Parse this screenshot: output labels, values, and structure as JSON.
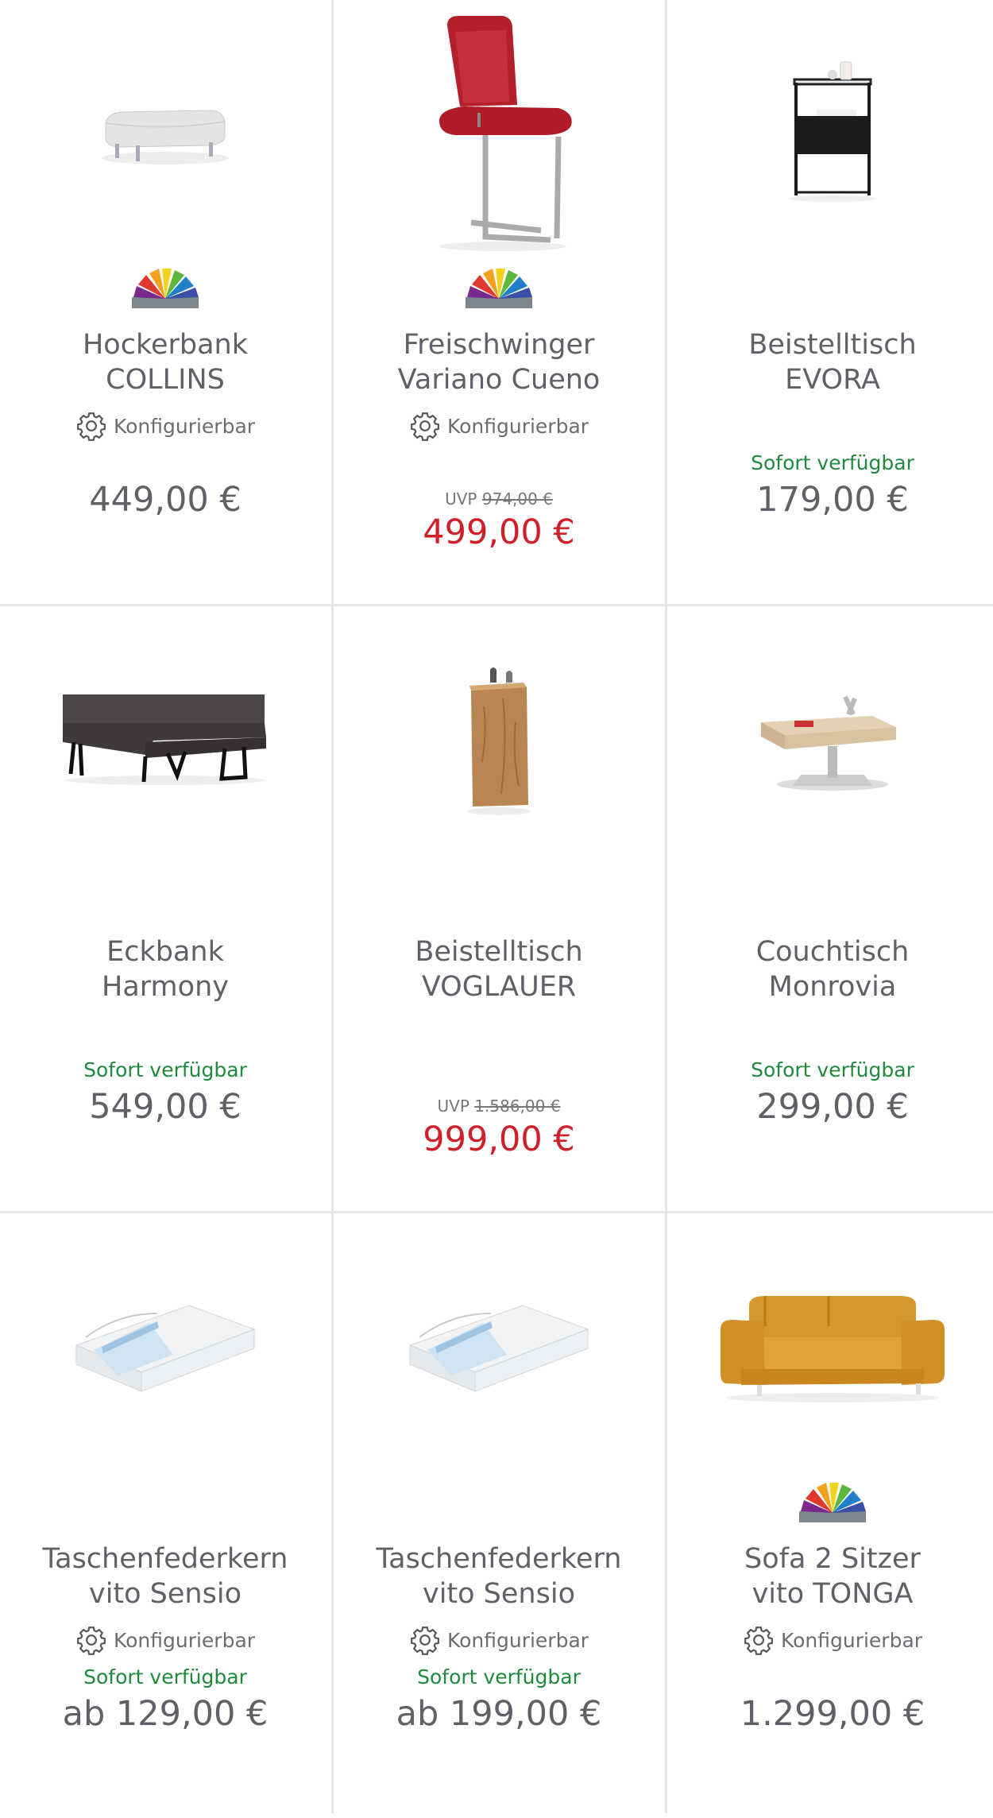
{
  "products": [
    {
      "title_line1": "Hockerbank",
      "title_line2": "COLLINS",
      "configurable": "Konfigurierbar",
      "availability": "",
      "price": "449,00 €",
      "uvp_label": "",
      "uvp_price": "",
      "image": "ottoman-image",
      "has_colors": true
    },
    {
      "title_line1": "Freischwinger",
      "title_line2": "Variano Cueno",
      "configurable": "Konfigurierbar",
      "availability": "",
      "price": "",
      "uvp_label": "UVP",
      "uvp_price": "974,00 €",
      "sale_price": "499,00 €",
      "image": "chair-image",
      "has_colors": true
    },
    {
      "title_line1": "Beistelltisch",
      "title_line2": "EVORA",
      "configurable": "",
      "availability": "Sofort verfügbar",
      "price": "179,00 €",
      "uvp_label": "",
      "uvp_price": "",
      "image": "side-table-image",
      "has_colors": false
    },
    {
      "title_line1": "Eckbank",
      "title_line2": "Harmony",
      "configurable": "",
      "availability": "Sofort verfügbar",
      "price": "549,00 €",
      "uvp_label": "",
      "uvp_price": "",
      "image": "corner-bench-image",
      "has_colors": false
    },
    {
      "title_line1": "Beistelltisch",
      "title_line2": "VOGLAUER",
      "configurable": "",
      "availability": "",
      "price": "",
      "uvp_label": "UVP",
      "uvp_price": "1.586,00 €",
      "sale_price": "999,00 €",
      "image": "wood-pedestal-image",
      "has_colors": false
    },
    {
      "title_line1": "Couchtisch",
      "title_line2": "Monrovia",
      "configurable": "",
      "availability": "Sofort verfügbar",
      "price": "299,00 €",
      "uvp_label": "",
      "uvp_price": "",
      "image": "coffee-table-image",
      "has_colors": false
    },
    {
      "title_line1": "Taschenfederkern",
      "title_line2": "vito Sensio",
      "configurable": "Konfigurierbar",
      "availability": "Sofort verfügbar",
      "price": "ab 129,00 €",
      "uvp_label": "",
      "uvp_price": "",
      "image": "mattress-image",
      "has_colors": false
    },
    {
      "title_line1": "Taschenfederkern",
      "title_line2": "vito Sensio",
      "configurable": "Konfigurierbar",
      "availability": "Sofort verfügbar",
      "price": "ab 199,00 €",
      "uvp_label": "",
      "uvp_price": "",
      "image": "mattress-image",
      "has_colors": false
    },
    {
      "title_line1": "Sofa 2 Sitzer",
      "title_line2": "vito TONGA",
      "configurable": "Konfigurierbar",
      "availability": "",
      "price": "1.299,00 €",
      "uvp_label": "",
      "uvp_price": "",
      "image": "sofa-image",
      "has_colors": true
    }
  ],
  "colors": {
    "available": "#1f8a3c",
    "sale": "#cf1f28",
    "text": "#5f6166",
    "divider": "#e4e6ea"
  }
}
